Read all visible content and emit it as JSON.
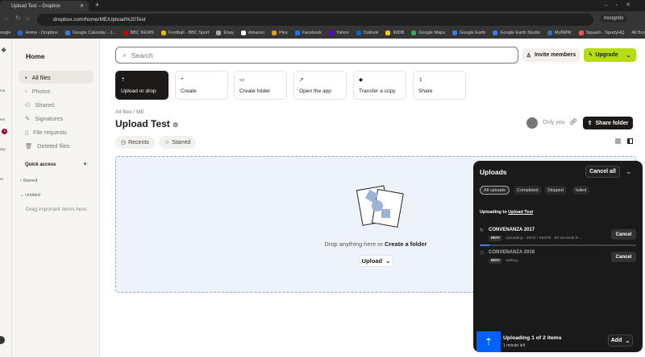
{
  "browser": {
    "tab_title": "Upload Test – Dropbox",
    "url": "dropbox.com/home/ME/Upload%20Test",
    "incognito": "Incognito",
    "bookmarks": [
      "oogle",
      "Home - Dropbox",
      "Google Calendar - J...",
      "BBC NEWS",
      "Football - BBC Sport",
      "Ebay",
      "Amazon",
      "Plex",
      "Facebook",
      "Yahoo",
      "Outlook",
      "IMDB",
      "Google Maps",
      "Google Earth",
      "Google Earth Studio",
      "MyBMW",
      "Squash - SportyHQ"
    ],
    "all_bookmarks": "All Bookmarks"
  },
  "rail": {
    "items": [
      "me",
      "ers",
      "vity",
      "re"
    ],
    "badge": "1"
  },
  "sidebar": {
    "title": "Home",
    "items": [
      {
        "label": "All files"
      },
      {
        "label": "Photos"
      },
      {
        "label": "Shared"
      },
      {
        "label": "Signatures"
      },
      {
        "label": "File requests"
      },
      {
        "label": "Deleted files"
      }
    ],
    "quick_access": "Quick access",
    "starred": "Starred",
    "untitled": "Untitled",
    "empty": "Drag important items here."
  },
  "header": {
    "search_placeholder": "Search",
    "invite": "Invite members",
    "upgrade": "Upgrade"
  },
  "actions": [
    "Upload or drop",
    "Create",
    "Create folder",
    "Open the app",
    "Transfer a copy",
    "Share"
  ],
  "breadcrumb": {
    "root": "All files",
    "sep": "/",
    "folder": "ME"
  },
  "folder": {
    "title": "Upload Test",
    "access": "Only you",
    "share": "Share folder"
  },
  "filters": {
    "recents": "Recents",
    "starred": "Starred"
  },
  "dropzone": {
    "text": "Drop anything here or",
    "link": "Create a folder",
    "upload": "Upload"
  },
  "uploads": {
    "title": "Uploads",
    "cancel_all": "Cancel all",
    "tabs": [
      "All uploads",
      "Completed",
      "Skipped",
      "failed"
    ],
    "dest_label": "Uploading to",
    "dest": "Upload Test",
    "items": [
      {
        "name": "CONVENANZA 2017",
        "type": "MOV",
        "status": "Uploading · 39mb / 662mb · 50 seconds le...",
        "progress": 0.06,
        "cancel": "Cancel"
      },
      {
        "name": "CONVENANZA 2018",
        "type": "MOV",
        "status": "waiting...",
        "cancel": "Cancel"
      }
    ],
    "footer_title": "Uploading 1 of 2 items",
    "footer_sub": "1 minute left",
    "add": "Add"
  },
  "colors": {
    "accent": "#0061fe",
    "upgrade": "#b4dc19"
  }
}
